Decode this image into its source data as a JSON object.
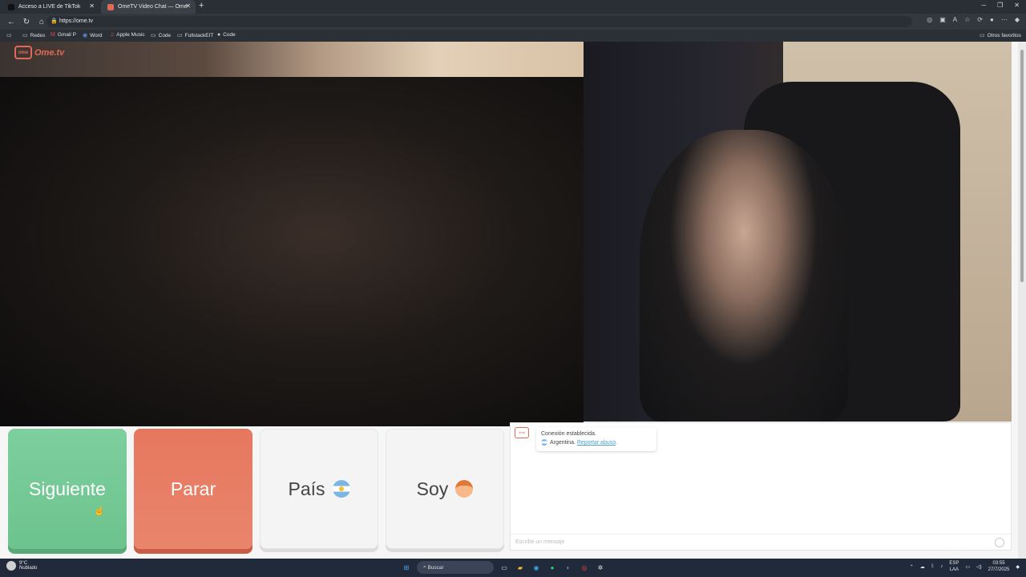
{
  "browser": {
    "tabs": [
      {
        "title": "Acceso a LIVE de TikTok",
        "favicon_color": "#111111"
      },
      {
        "title": "OmeTV Video Chat — Ome",
        "favicon_color": "#e06a55"
      }
    ],
    "url": "https://ome.tv",
    "bookmarks": [
      "Redes",
      "Gmail P",
      "Word",
      "Apple Music",
      "Code",
      "FullstackEIT",
      "Code"
    ],
    "other_favorites": "Otros favoritos"
  },
  "app": {
    "logo_text": "Ome.tv",
    "buttons": {
      "next": "Siguiente",
      "stop": "Parar",
      "country": "País",
      "gender": "Soy"
    }
  },
  "chat": {
    "connection": "Conexión establecida.",
    "country_line": "Argentina.",
    "report_link": "Reportar abuso",
    "placeholder": "Escribe un mensaje"
  },
  "taskbar": {
    "weather_temp": "9°C",
    "weather_desc": "Nublado",
    "search_label": "Buscar",
    "lang_top": "ESP",
    "lang_bottom": "LAA",
    "time": "03:55",
    "date": "27/7/2025"
  },
  "colors": {
    "next_green": "#7ecf9e",
    "stop_red": "#e6775e",
    "brand": "#e06a55"
  }
}
